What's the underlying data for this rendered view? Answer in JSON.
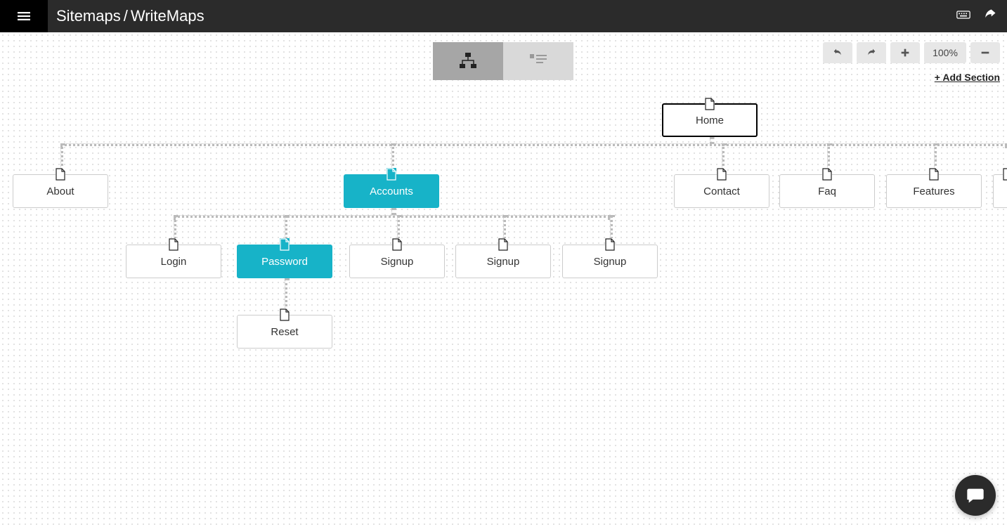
{
  "header": {
    "breadcrumb_root": "Sitemaps",
    "breadcrumb_current": "WriteMaps"
  },
  "toolbar": {
    "zoom_label": "100%",
    "add_section_label": "+ Add Section"
  },
  "nodes": {
    "home": {
      "label": "Home"
    },
    "about": {
      "label": "About"
    },
    "accounts": {
      "label": "Accounts"
    },
    "contact": {
      "label": "Contact"
    },
    "faq": {
      "label": "Faq"
    },
    "features": {
      "label": "Features"
    },
    "login": {
      "label": "Login"
    },
    "password": {
      "label": "Password"
    },
    "signup1": {
      "label": "Signup"
    },
    "signup2": {
      "label": "Signup"
    },
    "signup3": {
      "label": "Signup"
    },
    "reset": {
      "label": "Reset"
    }
  },
  "colors": {
    "accent": "#17b3c8",
    "header_bg": "#2b2b2b"
  }
}
